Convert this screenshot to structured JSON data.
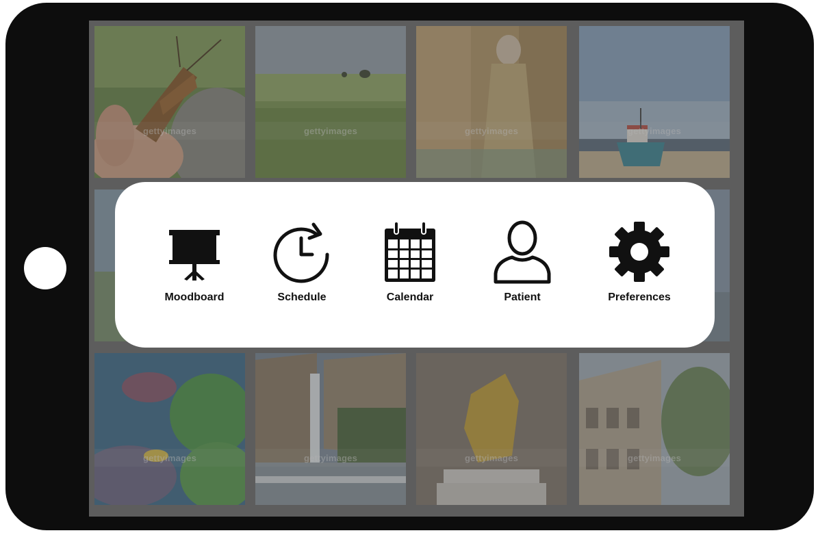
{
  "device": {
    "type": "tablet",
    "frame_color": "#0d0d0d",
    "home_button_color": "#ffffff"
  },
  "background_grid": {
    "watermark_text": "gettyimages",
    "tiles": [
      {
        "subject": "grasshopper on hand"
      },
      {
        "subject": "green field with trees"
      },
      {
        "subject": "golden portrait painting"
      },
      {
        "subject": "boat on beach"
      },
      {
        "subject": "partially hidden tile"
      },
      {
        "subject": "partially hidden tile"
      },
      {
        "subject": "partially hidden tile"
      },
      {
        "subject": "partially hidden tile"
      },
      {
        "subject": "coral reef"
      },
      {
        "subject": "waterfall canyon"
      },
      {
        "subject": "golden statue"
      },
      {
        "subject": "colosseum"
      }
    ]
  },
  "menu": {
    "items": [
      {
        "label": "Moodboard",
        "icon": "presentation-board-icon"
      },
      {
        "label": "Schedule",
        "icon": "clock-refresh-icon"
      },
      {
        "label": "Calendar",
        "icon": "calendar-icon"
      },
      {
        "label": "Patient",
        "icon": "person-icon"
      },
      {
        "label": "Preferences",
        "icon": "gear-icon"
      }
    ],
    "panel_color": "#ffffff",
    "text_color": "#111111"
  }
}
